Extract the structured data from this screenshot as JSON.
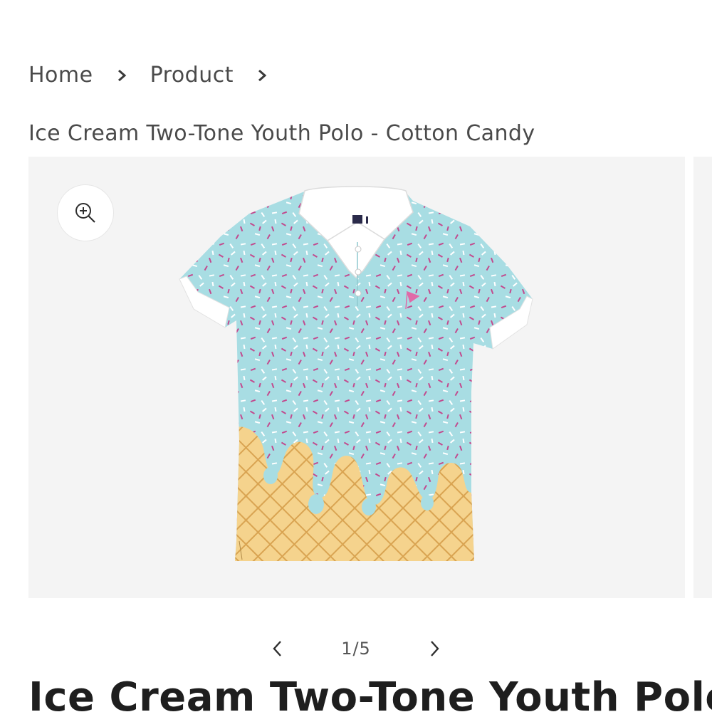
{
  "breadcrumb": {
    "items": [
      {
        "label": "Home"
      },
      {
        "label": "Product"
      }
    ]
  },
  "product": {
    "subtitle": "Ice Cream Two-Tone Youth Polo - Cotton Candy",
    "title": "Ice Cream Two-Tone Youth Polo"
  },
  "gallery": {
    "counter": "1/5",
    "current": 1,
    "total": 5,
    "zoom_icon": "zoom-in-icon",
    "prev_icon": "chevron-left-icon",
    "next_icon": "chevron-right-icon"
  },
  "colors": {
    "text": "#4a4a4a",
    "title": "#1e1e1e",
    "gallery_bg": "#f4f4f4",
    "shirt_blue": "#a8dde3",
    "cone": "#f3cf86",
    "sprinkle_pink": "#c24a8e"
  }
}
